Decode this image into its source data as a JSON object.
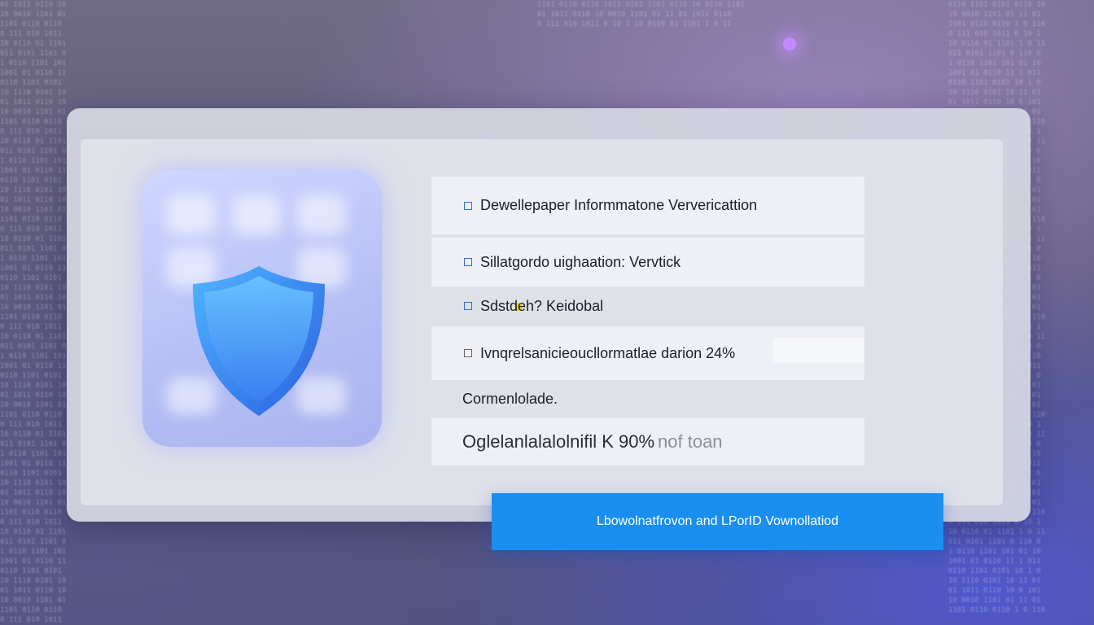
{
  "rows": [
    {
      "text": "Dewellepaper Informmatone Ververicattion",
      "icon": "user-icon"
    },
    {
      "text": "Sillatgordo uighaation: Vervtick",
      "icon": "stack-icon"
    },
    {
      "text": "Sdstdeh? Keidobal",
      "icon": ""
    },
    {
      "text": "Ivnqrelsanicieoucllormatlae darion 24%",
      "icon": "mail-icon"
    },
    {
      "text": "Cormenlolade.",
      "icon": ""
    },
    {
      "text": "Oglelanlalalolnifil K 90%",
      "tail": "nof toan",
      "icon": "shield-small-icon"
    }
  ],
  "cta": {
    "label": "Lbowolnatfrovon and LPorID Vownollatiod"
  },
  "colors": {
    "accent": "#1b8ff0",
    "shield": "#3a8cf0",
    "highlight": "#e5d80f"
  }
}
